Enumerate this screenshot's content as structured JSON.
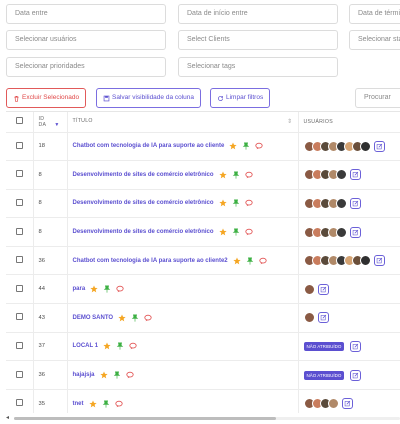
{
  "filters": {
    "date_start": "Data entre",
    "date_start_2": "Data de início entre",
    "date_end": "Data de término",
    "users": "Selecionar usuários",
    "clients": "Select Clients",
    "status": "Selecionar status",
    "priorities": "Selecionar prioridades",
    "tags": "Selecionar tags",
    "search": "Procurar"
  },
  "toolbar": {
    "delete_label": "Excluir Selecionado",
    "save_visibility_label": "Salvar visibilidade da coluna",
    "clear_filters_label": "Limpar filtros"
  },
  "table": {
    "headers": {
      "id": "ID DA",
      "title": "TÍTULO",
      "users": "USUÁRIOS"
    },
    "rows": [
      {
        "id": "18",
        "title": "Chatbot com tecnologia de IA para suporte ao cliente",
        "avatars": 8,
        "badge": ""
      },
      {
        "id": "8",
        "title": "Desenvolvimento de sites de comércio eletrônico",
        "avatars": 5,
        "badge": ""
      },
      {
        "id": "8",
        "title": "Desenvolvimento de sites de comércio eletrônico",
        "avatars": 5,
        "badge": ""
      },
      {
        "id": "8",
        "title": "Desenvolvimento de sites de comércio eletrônico",
        "avatars": 5,
        "badge": ""
      },
      {
        "id": "36",
        "title": "Chatbot com tecnologia de IA para suporte ao cliente2",
        "avatars": 8,
        "badge": ""
      },
      {
        "id": "44",
        "title": "para",
        "avatars": 1,
        "badge": ""
      },
      {
        "id": "43",
        "title": "DEMO SANTO",
        "avatars": 1,
        "badge": ""
      },
      {
        "id": "37",
        "title": "LOCAL 1",
        "avatars": 0,
        "badge": "NÃO ATRIBUÍDO"
      },
      {
        "id": "36",
        "title": "hajajsja",
        "avatars": 0,
        "badge": "NÃO ATRIBUÍDO"
      },
      {
        "id": "35",
        "title": "tnet",
        "avatars": 4,
        "badge": ""
      }
    ]
  },
  "colors": {
    "accent": "#5b4fd0",
    "danger": "#e04848",
    "star_filled": "#f5a623",
    "pin": "#3cb043",
    "chat": "#e04848"
  }
}
